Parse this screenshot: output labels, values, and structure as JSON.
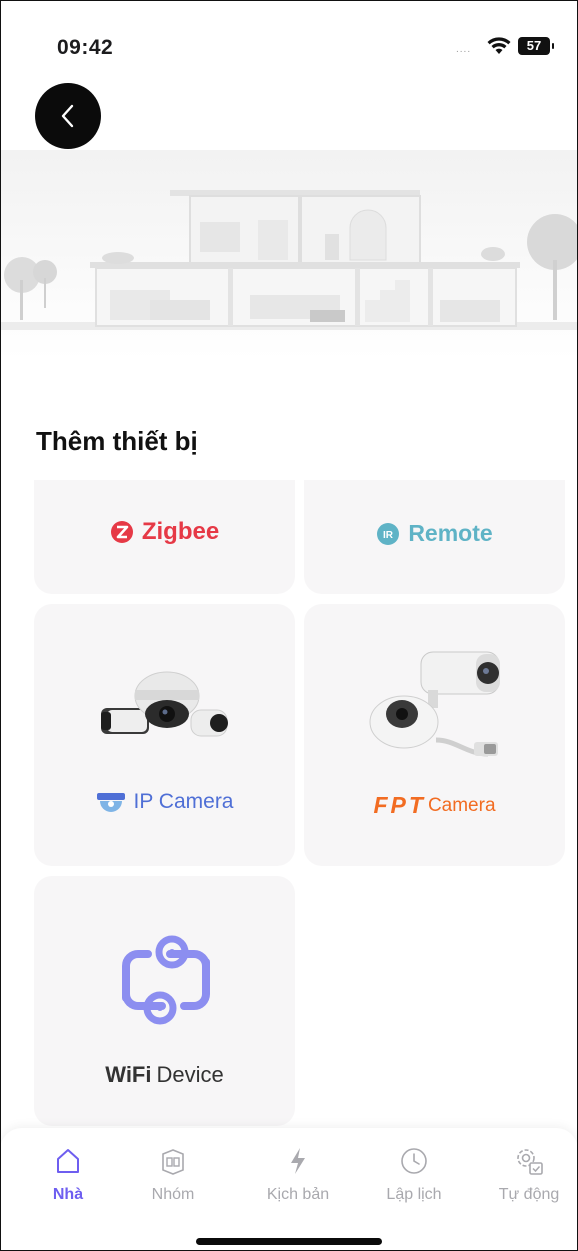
{
  "status_bar": {
    "time": "09:42",
    "signal": "....",
    "battery": "57"
  },
  "section_title": "Thêm thiết bị",
  "devices": [
    {
      "name": "zigbee",
      "label": "Zigbee",
      "icon": "zigbee-logo-icon",
      "color": "#e63946"
    },
    {
      "name": "remote",
      "label": "Remote",
      "icon": "ir-icon",
      "color": "#5fb3c6"
    },
    {
      "name": "ip-camera",
      "label": "IP Camera",
      "icon": "ip-camera-logo-icon",
      "color": "#4f6fd6"
    },
    {
      "name": "fpt-camera",
      "label_brand": "FPT",
      "label": "Camera",
      "icon": "fpt-camera-icon",
      "color": "#f26c22"
    },
    {
      "name": "wifi-device",
      "label_bold": "WiFi",
      "label": "Device",
      "icon": "wifi-device-icon",
      "color": "#8c8ef0"
    }
  ],
  "tabs": [
    {
      "label": "Nhà",
      "icon": "home-icon",
      "active": true
    },
    {
      "label": "Nhóm",
      "icon": "group-icon",
      "active": false
    },
    {
      "label": "Kịch bản",
      "icon": "bolt-icon",
      "active": false
    },
    {
      "label": "Lập lịch",
      "icon": "clock-icon",
      "active": false
    },
    {
      "label": "Tự động",
      "icon": "automation-gear-icon",
      "active": false
    }
  ],
  "colors": {
    "accent": "#6e5ef0",
    "card_bg": "#f7f6f7",
    "inactive": "#a9a9ae"
  }
}
